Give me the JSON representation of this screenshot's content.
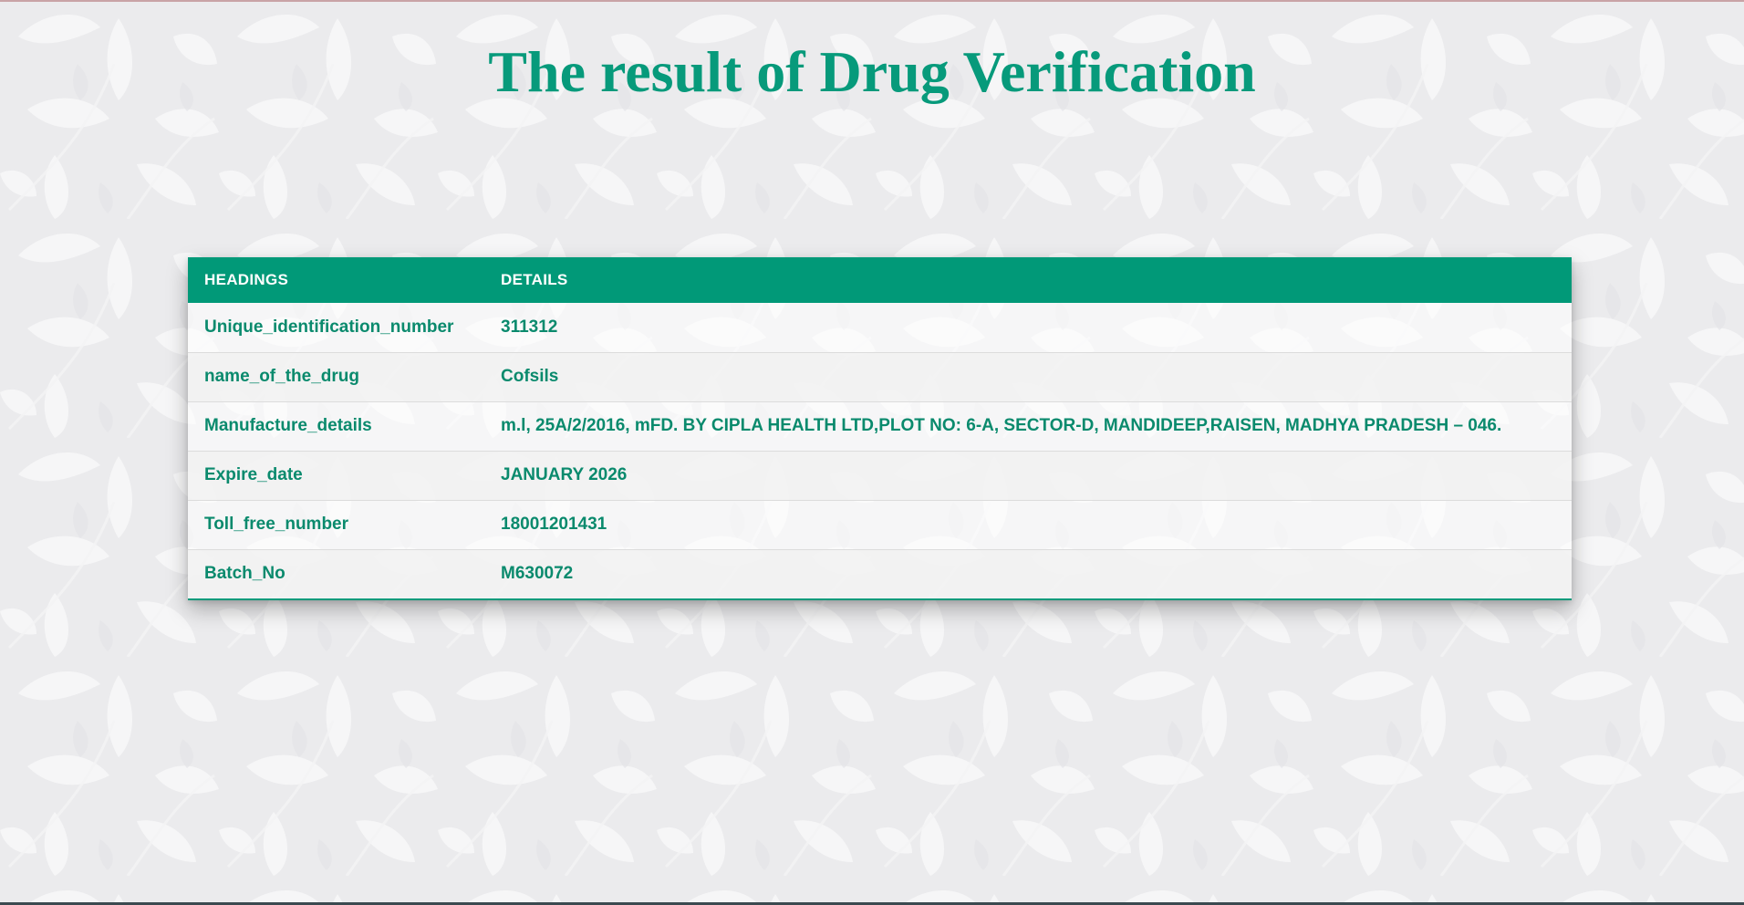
{
  "page": {
    "title": "The result of Drug Verification"
  },
  "table": {
    "headers": {
      "heading": "HEADINGS",
      "details": "DETAILS"
    },
    "rows": [
      {
        "heading": "Unique_identification_number",
        "detail": "311312"
      },
      {
        "heading": "name_of_the_drug",
        "detail": "Cofsils"
      },
      {
        "heading": "Manufacture_details",
        "detail": "m.l, 25A/2/2016, mFD. BY CIPLA HEALTH LTD,PLOT NO: 6-A, SECTOR-D, MANDIDEEP,RAISEN, MADHYA PRADESH – 046."
      },
      {
        "heading": "Expire_date",
        "detail": "JANUARY 2026"
      },
      {
        "heading": "Toll_free_number",
        "detail": "18001201431"
      },
      {
        "heading": "Batch_No",
        "detail": "M630072"
      }
    ]
  },
  "colors": {
    "accent": "#019978",
    "text_green": "#0a8a6d",
    "background": "#ebebed"
  },
  "icons": {
    "background": "leaf-pattern"
  }
}
